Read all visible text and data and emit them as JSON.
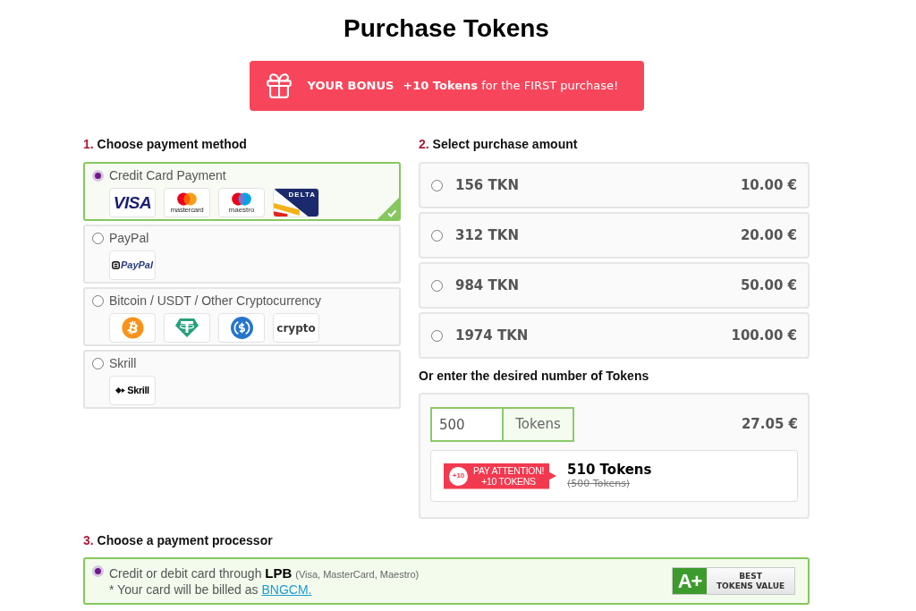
{
  "title": "Purchase Tokens",
  "bonus_banner": {
    "label": "YOUR BONUS",
    "text": "**+10 Tokens** for the FIRST purchase!"
  },
  "payment_method": {
    "number": "1.",
    "heading": "Choose payment method",
    "options": [
      {
        "label": "Credit Card Payment",
        "selected": true,
        "logos": [
          {
            "kind": "visa",
            "text": "VISA"
          },
          {
            "kind": "mastercard",
            "text": "mastercard"
          },
          {
            "kind": "maestro",
            "text": "maestro"
          },
          {
            "kind": "delta",
            "text": "DELTA"
          }
        ]
      },
      {
        "label": "PayPal",
        "selected": false,
        "logos": [
          {
            "kind": "paypal",
            "text": "PayPal"
          }
        ]
      },
      {
        "label": "Bitcoin / USDT / Other Cryptocurrency",
        "selected": false,
        "logos": [
          {
            "kind": "bitcoin"
          },
          {
            "kind": "tether"
          },
          {
            "kind": "usdc"
          },
          {
            "kind": "crypto",
            "text": "crypto"
          }
        ]
      },
      {
        "label": "Skrill",
        "selected": false,
        "logos": [
          {
            "kind": "skrill",
            "text": "Skrill"
          }
        ]
      }
    ]
  },
  "purchase_amount": {
    "number": "2.",
    "heading": "Select purchase amount",
    "options": [
      {
        "tokens": "156 TKN",
        "price": "10.00 €",
        "selected": false
      },
      {
        "tokens": "312 TKN",
        "price": "20.00 €",
        "selected": false
      },
      {
        "tokens": "984 TKN",
        "price": "50.00 €",
        "selected": false
      },
      {
        "tokens": "1974 TKN",
        "price": "100.00 €",
        "selected": false
      }
    ],
    "custom": {
      "heading": "Or enter the desired number of Tokens",
      "value": "500",
      "unit": "Tokens",
      "price": "27.05 €",
      "bonus": {
        "circle": "+10",
        "title": "PAY ATTENTION!",
        "subtitle": "+10 TOKENS"
      },
      "total": "510 Tokens",
      "original": "(500 Tokens)"
    }
  },
  "payment_processor": {
    "number": "3.",
    "heading": "Choose a payment processor",
    "options": [
      {
        "lead": "Credit or debit card through",
        "name": "LPB",
        "note": "(Visa, MasterCard, Maestro)",
        "billing": "* Your card will be billed as",
        "billing_link": "BNGCM.",
        "selected": true,
        "badge": {
          "grade": "A+",
          "lines": [
            "BEST",
            "TOKENS VALUE"
          ]
        }
      }
    ]
  }
}
